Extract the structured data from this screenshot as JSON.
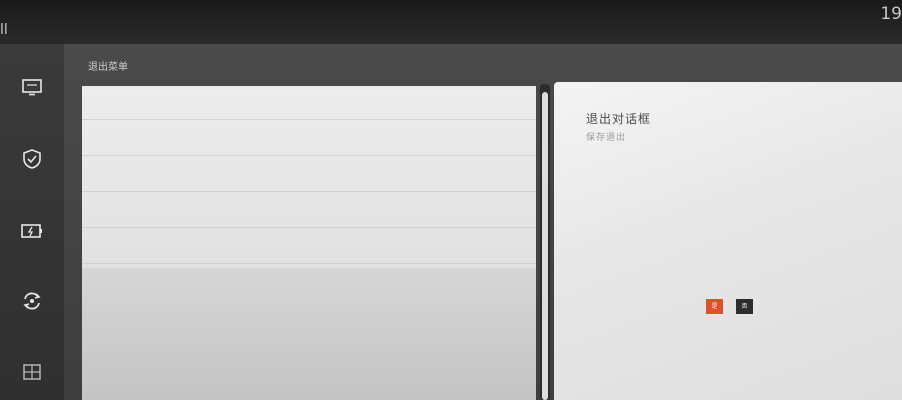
{
  "topbar": {
    "app_mark": "ll",
    "status_text": "",
    "clock": "19"
  },
  "sidebar": {
    "items": [
      {
        "icon": "monitor-icon",
        "label": ""
      },
      {
        "icon": "shield-icon",
        "label": ""
      },
      {
        "icon": "battery-icon",
        "label": ""
      },
      {
        "icon": "refresh-icon",
        "label": ""
      },
      {
        "icon": "grid-icon",
        "label": ""
      }
    ]
  },
  "main": {
    "section_title": "退出菜单",
    "list": [
      {
        "label": ""
      },
      {
        "label": ""
      },
      {
        "label": ""
      },
      {
        "label": ""
      },
      {
        "label": ""
      }
    ]
  },
  "dialog": {
    "title": "退出对话框",
    "subtitle": "保存退出",
    "confirm_label": "是",
    "cancel_label": "否",
    "confirm_color": "#e34f2a",
    "cancel_color": "#2d2d2d"
  }
}
